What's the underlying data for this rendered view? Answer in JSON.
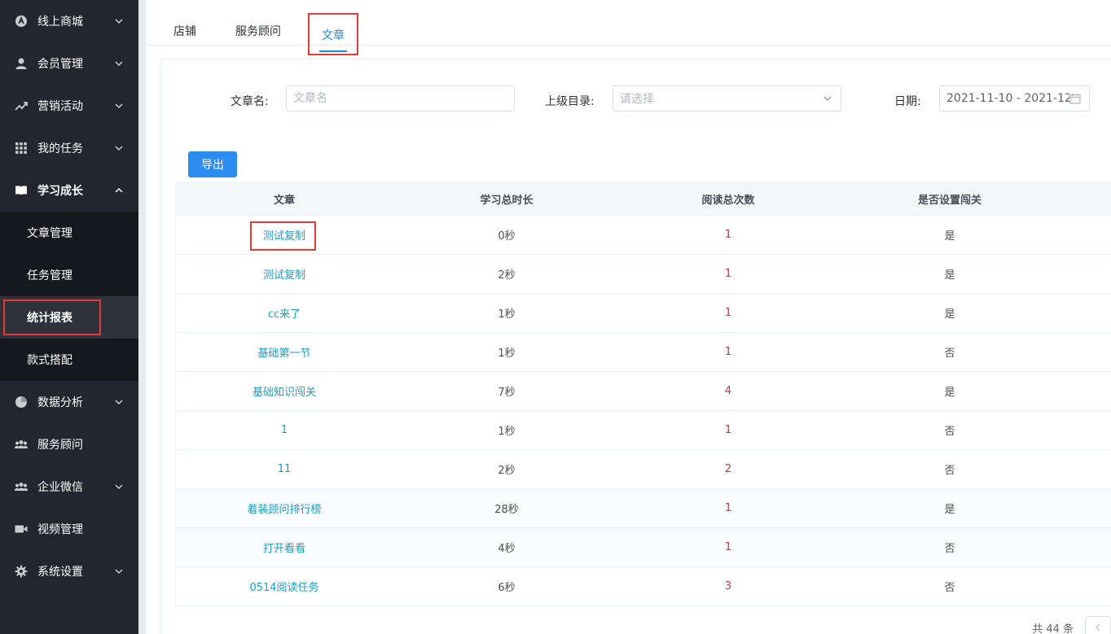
{
  "sidebar": {
    "items": [
      {
        "label": "线上商城",
        "icon": "store-icon",
        "has_chevron": true
      },
      {
        "label": "会员管理",
        "icon": "user-icon",
        "has_chevron": true
      },
      {
        "label": "营销活动",
        "icon": "trend-icon",
        "has_chevron": true
      },
      {
        "label": "我的任务",
        "icon": "grid-icon",
        "has_chevron": true
      },
      {
        "label": "学习成长",
        "icon": "book-icon",
        "has_chevron": true,
        "expanded": true
      },
      {
        "label": "数据分析",
        "icon": "pie-chart-icon",
        "has_chevron": true
      },
      {
        "label": "服务顾问",
        "icon": "team-icon",
        "has_chevron": false
      },
      {
        "label": "企业微信",
        "icon": "team-icon",
        "has_chevron": true
      },
      {
        "label": "视频管理",
        "icon": "video-icon",
        "has_chevron": false
      },
      {
        "label": "系统设置",
        "icon": "gear-icon",
        "has_chevron": true
      }
    ],
    "sub_items": [
      {
        "label": "文章管理"
      },
      {
        "label": "任务管理"
      },
      {
        "label": "统计报表",
        "active": true
      },
      {
        "label": "款式搭配"
      }
    ]
  },
  "tabs": [
    {
      "label": "店铺"
    },
    {
      "label": "服务顾问"
    },
    {
      "label": "文章",
      "active": true
    }
  ],
  "filters": {
    "name_label": "文章名:",
    "name_placeholder": "文章名",
    "parent_label": "上级目录:",
    "parent_placeholder": "请选择",
    "date_label": "日期:",
    "date_value": "2021-11-10 - 2021-12-"
  },
  "export_label": "导出",
  "table": {
    "headers": [
      "文章",
      "学习总时长",
      "阅读总次数",
      "是否设置闯关"
    ],
    "rows": [
      {
        "title": "测试复制",
        "duration": "0秒",
        "reads": "1",
        "gate": "是"
      },
      {
        "title": "测试复制",
        "duration": "2秒",
        "reads": "1",
        "gate": "是"
      },
      {
        "title": "cc来了",
        "duration": "1秒",
        "reads": "1",
        "gate": "是"
      },
      {
        "title": "基础第一节",
        "duration": "1秒",
        "reads": "1",
        "gate": "否"
      },
      {
        "title": "基础知识闯关",
        "duration": "7秒",
        "reads": "4",
        "gate": "是"
      },
      {
        "title": "1",
        "duration": "1秒",
        "reads": "1",
        "gate": "否"
      },
      {
        "title": "11",
        "duration": "2秒",
        "reads": "2",
        "gate": "否"
      },
      {
        "title": "着装顾问排行榜",
        "duration": "28秒",
        "reads": "1",
        "gate": "是"
      },
      {
        "title": "打开看看",
        "duration": "4秒",
        "reads": "1",
        "gate": "否"
      },
      {
        "title": "0514阅读任务",
        "duration": "6秒",
        "reads": "3",
        "gate": "否"
      }
    ]
  },
  "pagination": {
    "total_text": "共 44 条"
  },
  "colors": {
    "accent": "#2d8cf0",
    "link": "#1aa1c7",
    "highlight": "#e53935",
    "sidebar_bg": "#23262e"
  }
}
